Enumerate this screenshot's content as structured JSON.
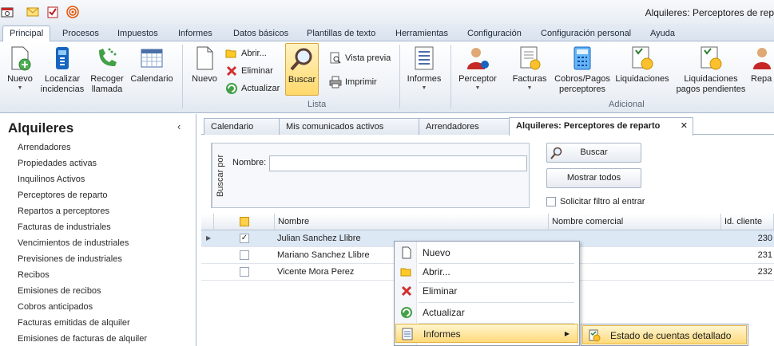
{
  "window": {
    "title": "Alquileres: Perceptores de rep"
  },
  "quick_access": [
    "app-icon",
    "mail-icon",
    "tasks-icon",
    "rss-icon"
  ],
  "ribbon_tabs": [
    "Principal",
    "Procesos",
    "Impuestos",
    "Informes",
    "Datos básicos",
    "Plantillas de texto",
    "Herramientas",
    "Configuración",
    "Configuración personal",
    "Ayuda"
  ],
  "ribbon": {
    "nuevo1": "Nuevo",
    "localizar": [
      "Localizar",
      "incidencias"
    ],
    "recoger": [
      "Recoger",
      "llamada"
    ],
    "calendario": "Calendario",
    "nuevo2": "Nuevo",
    "abrir": "Abrir...",
    "eliminar": "Eliminar",
    "actualizar": "Actualizar",
    "buscar": "Buscar",
    "vista_previa": "Vista previa",
    "imprimir": "Imprimir",
    "informes": "Informes",
    "grupo_lista": "Lista",
    "perceptor": "Perceptor",
    "facturas": "Facturas",
    "cobros": [
      "Cobros/Pagos",
      "perceptores"
    ],
    "liquidaciones": "Liquidaciones",
    "liq_pend": [
      "Liquidaciones",
      "pagos pendientes"
    ],
    "repa": "Repa",
    "grupo_adicional": "Adicional"
  },
  "nav": {
    "title": "Alquileres",
    "collapse": "‹",
    "items": [
      "Arrendadores",
      "Propiedades activas",
      "Inquilinos Activos",
      "Perceptores de reparto",
      "Repartos a perceptores",
      "Facturas de industriales",
      "Vencimientos de industriales",
      "Previsiones de industriales",
      "Recibos",
      "Emisiones de recibos",
      "Cobros anticipados",
      "Facturas emitidas de alquiler",
      "Emisiones de facturas de alquiler"
    ]
  },
  "doc_tabs": [
    "Calendario",
    "Mis comunicados activos",
    "Arrendadores",
    "Alquileres: Perceptores de reparto"
  ],
  "doc_tab_close": "✕",
  "search": {
    "group_label": "Buscar por",
    "name_label": "Nombre:",
    "name_value": "",
    "buscar_btn": "Buscar",
    "mostrar_btn": "Mostrar todos",
    "filtro_label": "Solicitar filtro al entrar"
  },
  "grid": {
    "headers": [
      "Nombre",
      "Nombre comercial",
      "Id. cliente"
    ],
    "rows": [
      {
        "nombre": "Julian Sanchez Llibre",
        "comercial": "",
        "id": "230",
        "checked": true
      },
      {
        "nombre": "Mariano Sanchez Llibre",
        "comercial": "",
        "id": "231",
        "checked": false
      },
      {
        "nombre": "Vicente Mora Perez",
        "comercial": "",
        "id": "232",
        "checked": false
      }
    ]
  },
  "context_menu": {
    "items": [
      "Nuevo",
      "Abrir...",
      "Eliminar",
      "Actualizar",
      "Informes"
    ],
    "submenu_arrow": "▶",
    "submenu": [
      "Estado de cuentas detallado"
    ]
  },
  "colors": {
    "accent": "#ffd86a",
    "ribbon_border": "#a6b7cc",
    "selection": "#dde8f5"
  }
}
